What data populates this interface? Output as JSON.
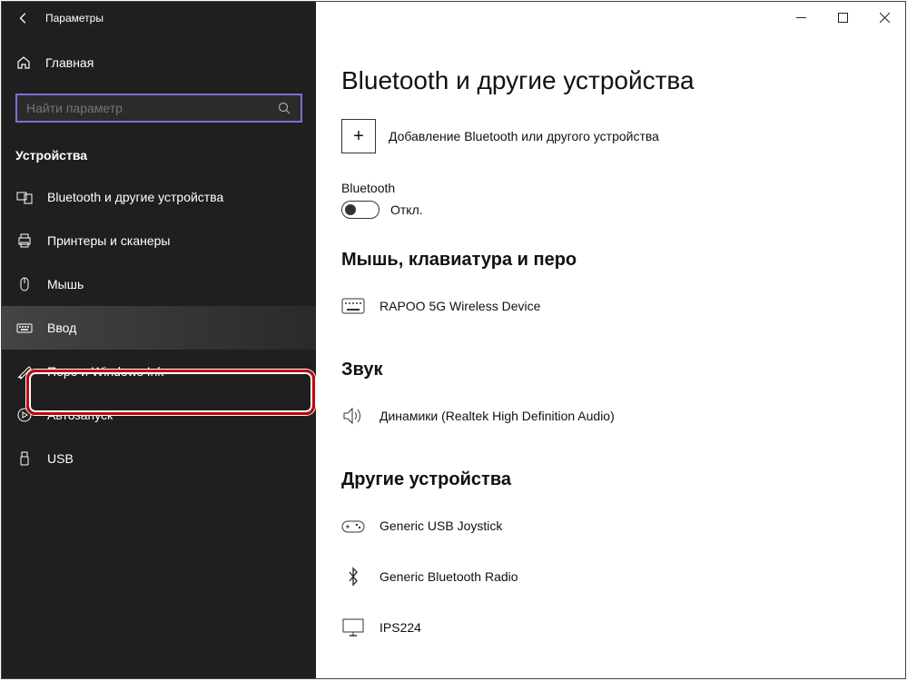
{
  "titlebar": {
    "app_title": "Параметры"
  },
  "sidebar": {
    "home_label": "Главная",
    "search_placeholder": "Найти параметр",
    "section_title": "Устройства",
    "items": [
      {
        "label": "Bluetooth и другие устройства"
      },
      {
        "label": "Принтеры и сканеры"
      },
      {
        "label": "Мышь"
      },
      {
        "label": "Ввод"
      },
      {
        "label": "Перо и Windows Ink"
      },
      {
        "label": "Автозапуск"
      },
      {
        "label": "USB"
      }
    ]
  },
  "main": {
    "page_title": "Bluetooth и другие устройства",
    "add_device_label": "Добавление Bluetooth или другого устройства",
    "bluetooth_label": "Bluetooth",
    "bluetooth_state": "Откл.",
    "section_mouse": "Мышь, клавиатура и перо",
    "device_rapoo": "RAPOO 5G Wireless Device",
    "section_sound": "Звук",
    "device_speakers": "Динамики (Realtek High Definition Audio)",
    "section_other": "Другие устройства",
    "device_joystick": "Generic   USB  Joystick",
    "device_btradio": "Generic Bluetooth Radio",
    "device_monitor": "IPS224"
  }
}
